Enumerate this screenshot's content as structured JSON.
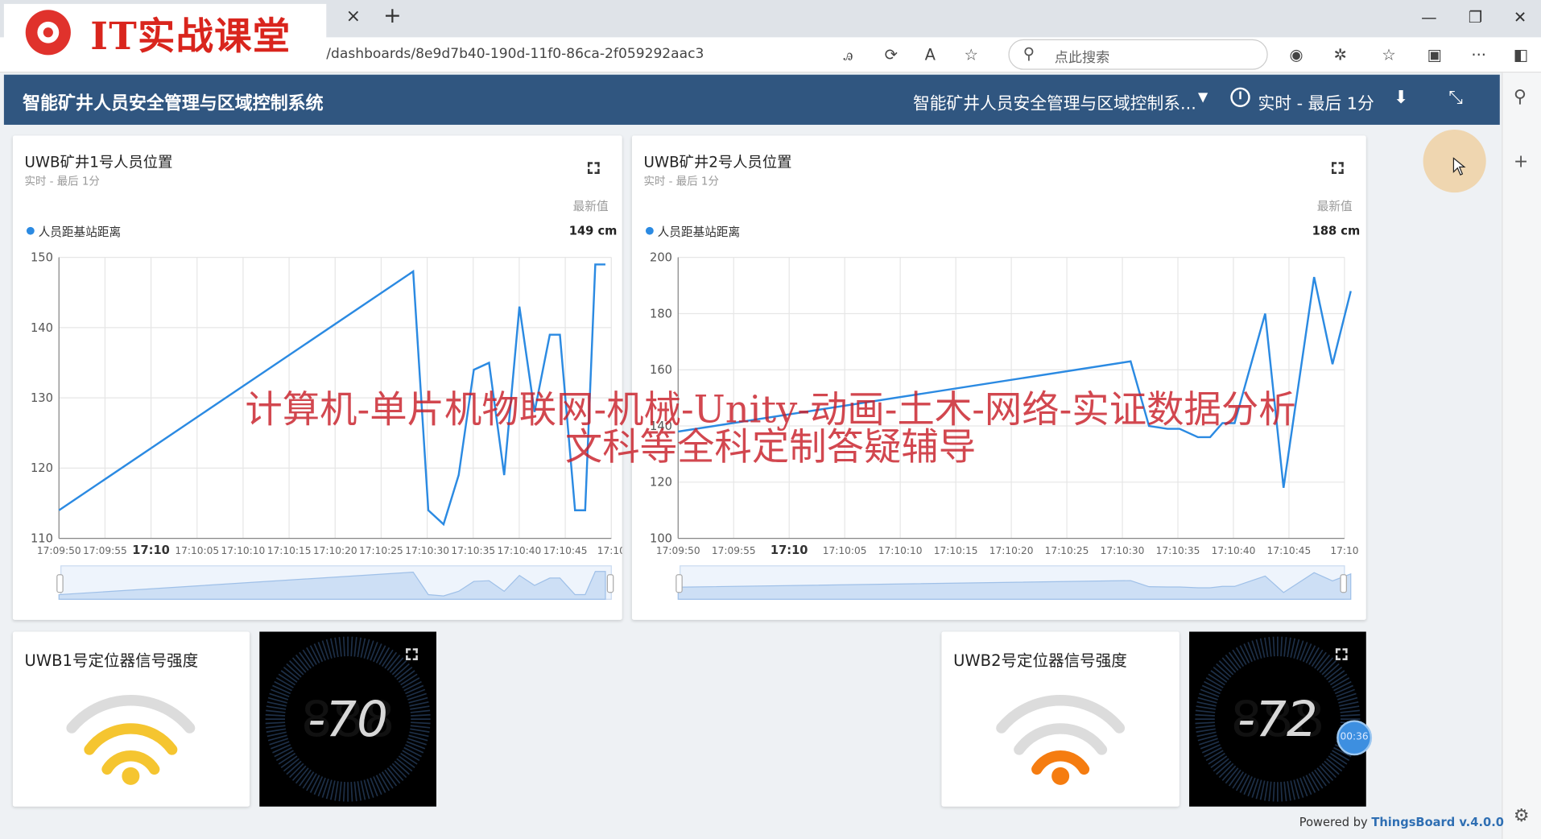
{
  "browser": {
    "logo_text": "IT实战课堂",
    "url": "/dashboards/8e9d7b40-190d-11f0-86ca-2f059292aac3",
    "search_placeholder": "点此搜索",
    "tab_close": "×",
    "tab_new": "+"
  },
  "header": {
    "title": "智能矿井人员安全管理与区域控制系统",
    "dashboard_select": "智能矿井人员安全管理与区域控制系...",
    "realtime_label": "实时 - 最后 1分"
  },
  "widgets": {
    "chart1": {
      "title": "UWB矿井1号人员位置",
      "subtitle": "实时 - 最后 1分",
      "latest_header": "最新值",
      "legend": "人员距基站距离",
      "latest_value": "149 cm"
    },
    "chart2": {
      "title": "UWB矿井2号人员位置",
      "subtitle": "实时 - 最后 1分",
      "latest_header": "最新值",
      "legend": "人员距基站距离",
      "latest_value": "188 cm"
    },
    "signal1": {
      "title": "UWB1号定位器信号强度",
      "level": 3,
      "color": "#f5c530"
    },
    "signal2": {
      "title": "UWB2号定位器信号强度",
      "level": 2,
      "color": "#f57c10"
    },
    "gauge1": {
      "value": "-70"
    },
    "gauge2": {
      "value": "-72"
    }
  },
  "watermark": {
    "line1": "计算机-单片机物联网-机械-Unity-动画-土木-网络-实证数据分析",
    "line2": "文科等全科定制答疑辅导"
  },
  "footer": {
    "prefix": "Powered by ",
    "brand": "ThingsBoard v.4.0.0"
  },
  "timer_badge": "00:36",
  "chart_data": [
    {
      "type": "line",
      "title": "UWB矿井1号人员位置",
      "series": [
        {
          "name": "人员距基站距离",
          "color": "#2b8ae2",
          "points": [
            [
              0,
              114
            ],
            [
              70,
              148
            ],
            [
              73,
              114
            ],
            [
              76,
              112
            ],
            [
              79,
              119
            ],
            [
              82,
              134
            ],
            [
              85,
              135
            ],
            [
              88,
              119
            ],
            [
              91,
              143
            ],
            [
              94,
              128
            ],
            [
              97,
              139
            ],
            [
              99,
              139
            ],
            [
              102,
              114
            ],
            [
              104,
              114
            ],
            [
              106,
              149
            ],
            [
              108,
              149
            ]
          ]
        }
      ],
      "x_ticks": [
        "17:09:50",
        "17:09:55",
        "17:10",
        "17:10:05",
        "17:10:10",
        "17:10:15",
        "17:10:20",
        "17:10:25",
        "17:10:30",
        "17:10:35",
        "17:10:40",
        "17:10:45",
        "17:10"
      ],
      "ylim": [
        110,
        150
      ],
      "y_ticks": [
        110,
        120,
        130,
        140,
        150
      ],
      "grid": true
    },
    {
      "type": "line",
      "title": "UWB矿井2号人员位置",
      "series": [
        {
          "name": "人员距基站距离",
          "color": "#2b8ae2",
          "points": [
            [
              0,
              138
            ],
            [
              74,
              163
            ],
            [
              77,
              140
            ],
            [
              80,
              139
            ],
            [
              82,
              139
            ],
            [
              85,
              136
            ],
            [
              87,
              136
            ],
            [
              89,
              141
            ],
            [
              91,
              141
            ],
            [
              96,
              180
            ],
            [
              99,
              118
            ],
            [
              104,
              193
            ],
            [
              107,
              162
            ],
            [
              110,
              188
            ]
          ]
        }
      ],
      "x_ticks": [
        "17:09:50",
        "17:09:55",
        "17:10",
        "17:10:05",
        "17:10:10",
        "17:10:15",
        "17:10:20",
        "17:10:25",
        "17:10:30",
        "17:10:35",
        "17:10:40",
        "17:10:45",
        "17:10"
      ],
      "ylim": [
        100,
        200
      ],
      "y_ticks": [
        100,
        120,
        140,
        160,
        180,
        200
      ],
      "grid": true
    }
  ]
}
